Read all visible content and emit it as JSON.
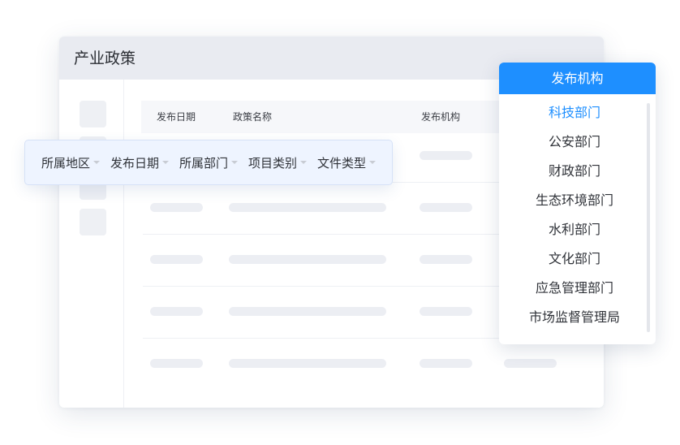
{
  "window": {
    "title": "产业政策"
  },
  "table": {
    "headers": [
      "发布日期",
      "政策名称",
      "发布机构"
    ]
  },
  "filters": [
    {
      "label": "所属地区"
    },
    {
      "label": "发布日期"
    },
    {
      "label": "所属部门"
    },
    {
      "label": "项目类别"
    },
    {
      "label": "文件类型"
    }
  ],
  "dropdown": {
    "title": "发布机构",
    "selected": "科技部门",
    "items": [
      "科技部门",
      "公安部门",
      "财政部门",
      "生态环境部门",
      "水利部门",
      "文化部门",
      "应急管理部门",
      "市场监督管理局"
    ]
  },
  "colors": {
    "accent": "#1e8fff",
    "header_bg": "#e9ebf1",
    "filter_bg": "#eef4ff",
    "skeleton": "#eceef3"
  },
  "icons": {
    "filter_caret": "caret-down-icon"
  }
}
